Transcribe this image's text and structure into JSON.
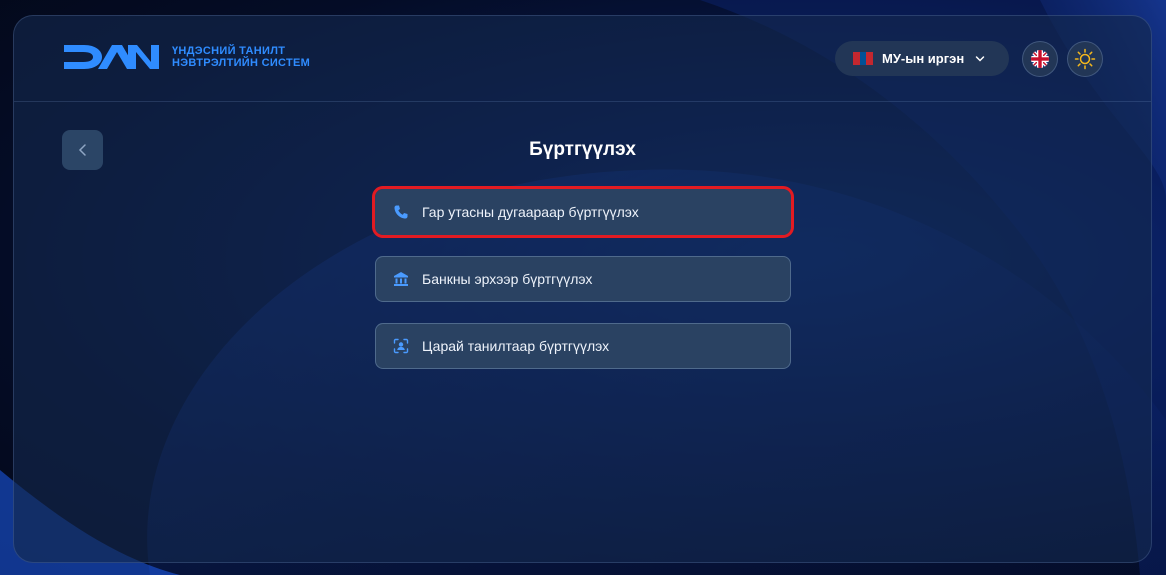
{
  "brand": {
    "logo_text": "DAN",
    "subtitle_line1": "ҮНДЭСНИЙ ТАНИЛТ",
    "subtitle_line2": "НЭВТРЭЛТИЙН СИСТЕМ"
  },
  "header": {
    "citizen_select": "МУ-ын иргэн",
    "lang_icon": "uk-flag-icon",
    "theme_icon": "sun-icon"
  },
  "page": {
    "title": "Бүртгүүлэх"
  },
  "options": [
    {
      "label": "Гар утасны дугаараар бүртгүүлэх",
      "icon": "phone-icon"
    },
    {
      "label": "Банкны эрхээр бүртгүүлэх",
      "icon": "bank-icon"
    },
    {
      "label": "Царай танилтаар бүртгүүлэх",
      "icon": "face-scan-icon"
    }
  ],
  "colors": {
    "accent": "#2f8cff",
    "highlight": "#e21b22",
    "card_bg": "#14284e"
  }
}
